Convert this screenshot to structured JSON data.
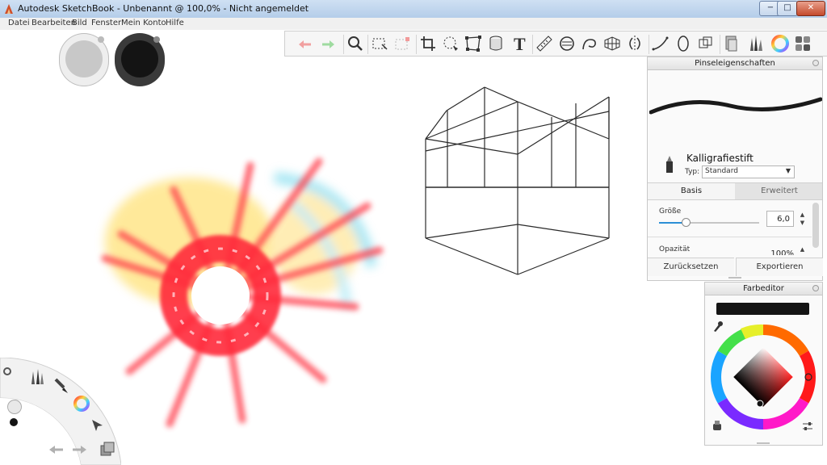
{
  "window": {
    "title": "Autodesk SketchBook - Unbenannt @ 100,0% - Nicht angemeldet",
    "minimize": "−",
    "maximize": "□",
    "close": "✕"
  },
  "menu": {
    "items": [
      "Datei",
      "Bearbeiten",
      "Bild",
      "Fenster",
      "Mein Konto",
      "Hilfe"
    ]
  },
  "toolbar": {
    "tools": [
      "undo-icon",
      "redo-icon",
      "zoom-icon",
      "select-icon",
      "select-extra-icon",
      "crop-icon",
      "lasso-transform-icon",
      "distort-icon",
      "cylinder-icon",
      "text-icon",
      "ruler-icon",
      "ellipse-guide-icon",
      "french-curve-icon",
      "perspective-grid-icon",
      "symmetry-icon",
      "stroke-icon",
      "shape-icon",
      "layers-icon",
      "copic-icon",
      "brush-library-icon",
      "color-wheel-icon",
      "swatches-icon"
    ],
    "text_tool_glyph": "T"
  },
  "colors": {
    "accent": "#2b8fd6",
    "primary_swatch": "#c8c8c8",
    "secondary_swatch": "#141414",
    "current_color": "#141414"
  },
  "brush_panel": {
    "title": "Pinseleigenschaften",
    "brush_name": "Kalligrafiestift",
    "type_label": "Typ:",
    "type_value": "Standard",
    "tab_basic": "Basis",
    "tab_advanced": "Erweitert",
    "size_label": "Größe",
    "size_value": "6,0",
    "opacity_label": "Opazität",
    "opacity_value": "100%",
    "reset_button": "Zurücksetzen",
    "export_button": "Exportieren"
  },
  "color_editor": {
    "title": "Farbeditor",
    "current_hex": "#141414"
  },
  "lagoon": {
    "tools": [
      "settings-icon",
      "brush-library-icon",
      "brush-icon",
      "color-wheel-icon",
      "select-arrow-icon",
      "layers-icon",
      "undo-icon",
      "redo-icon"
    ]
  }
}
